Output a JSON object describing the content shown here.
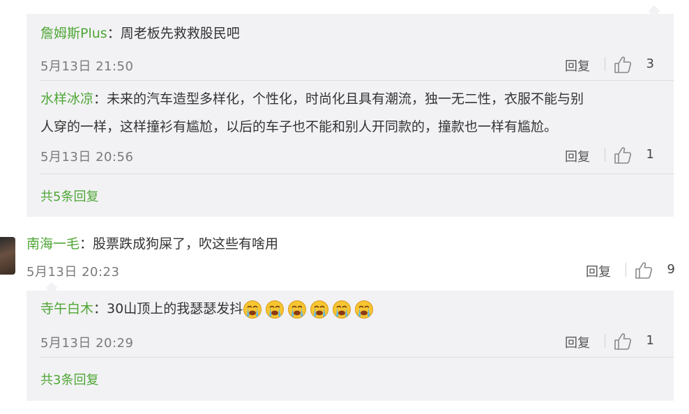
{
  "ui": {
    "reply_label": "回复"
  },
  "box1": {
    "replies": [
      {
        "user": "詹姆斯Plus",
        "text": "：周老板先救救股民吧",
        "time": "5月13日 21:50",
        "likes": "3"
      },
      {
        "user": "水样冰凉",
        "text_line1": "：未来的汽车造型多样化，个性化，时尚化且具有潮流，独一无二性，衣服不能与别",
        "text_line2": "人穿的一样，这样撞衫有尴尬，以后的车子也不能和别人开同款的，撞款也一样有尴尬。",
        "time": "5月13日 20:56",
        "likes": "1"
      }
    ],
    "more_label": "共5条回复"
  },
  "comment": {
    "user": "南海一毛",
    "text": "：股票跌成狗屎了，吹这些有啥用",
    "time": "5月13日 20:23",
    "likes": "9"
  },
  "box2": {
    "replies": [
      {
        "user": "寺午白木",
        "text": "：30山顶上的我瑟瑟发抖",
        "emoji_name": "crying-face-icon",
        "emoji_count": 6,
        "time": "5月13日 20:29",
        "likes": "1"
      }
    ],
    "more_label": "共3条回复"
  },
  "colors": {
    "username": "#4fa635",
    "reply_bg": "#f2f2f5",
    "meta": "#7a7a7a"
  }
}
